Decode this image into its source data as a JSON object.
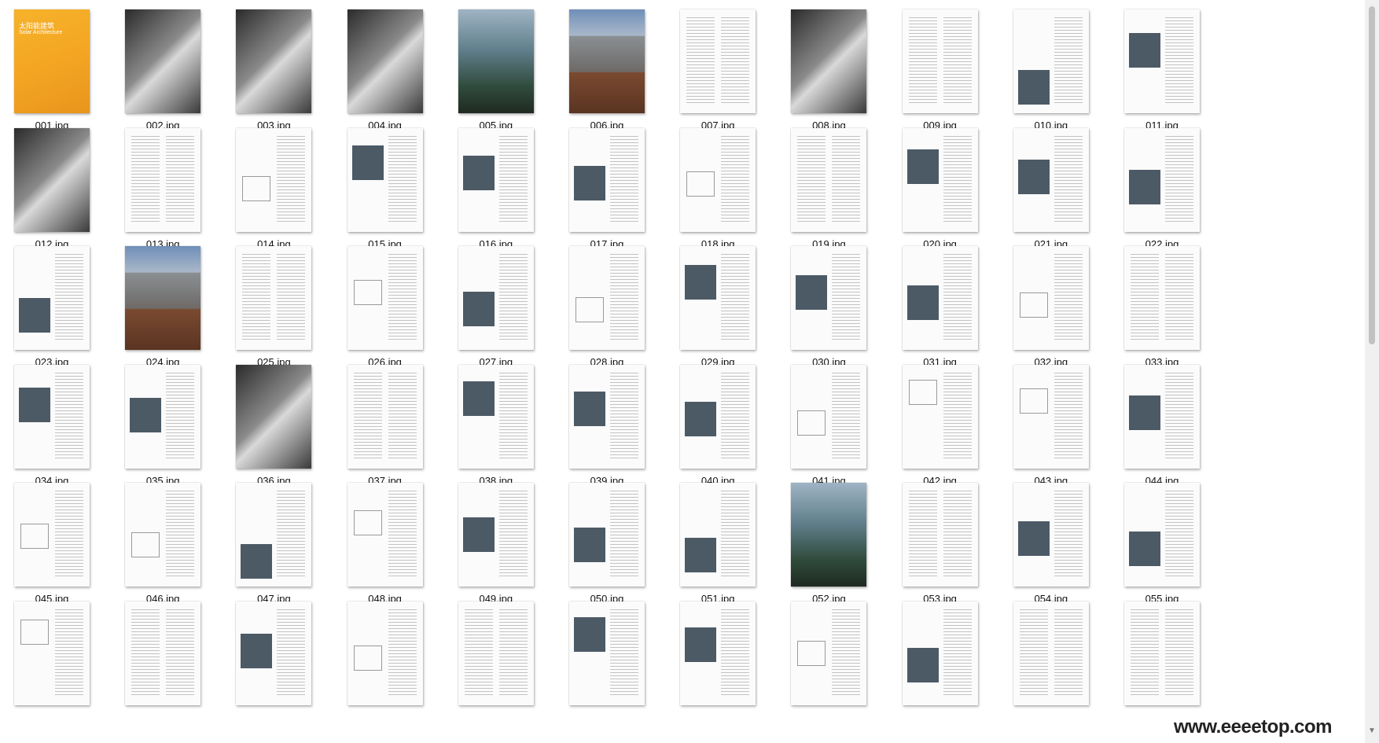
{
  "files": [
    {
      "name": "001.jpg",
      "kind": "cover",
      "cover_title": "太阳能建筑",
      "cover_subtitle": "Solar Architecture"
    },
    {
      "name": "002.jpg",
      "kind": "photo-dark"
    },
    {
      "name": "003.jpg",
      "kind": "photo-dark"
    },
    {
      "name": "004.jpg",
      "kind": "photo-dark"
    },
    {
      "name": "005.jpg",
      "kind": "photo-glass"
    },
    {
      "name": "006.jpg",
      "kind": "photo-building"
    },
    {
      "name": "007.jpg",
      "kind": "text"
    },
    {
      "name": "008.jpg",
      "kind": "photo-dark"
    },
    {
      "name": "009.jpg",
      "kind": "text"
    },
    {
      "name": "010.jpg",
      "kind": "text-photo"
    },
    {
      "name": "011.jpg",
      "kind": "text-photo"
    },
    {
      "name": "012.jpg",
      "kind": "photo-dark"
    },
    {
      "name": "013.jpg",
      "kind": "text"
    },
    {
      "name": "014.jpg",
      "kind": "text-diagram"
    },
    {
      "name": "015.jpg",
      "kind": "text-photo"
    },
    {
      "name": "016.jpg",
      "kind": "text-photo"
    },
    {
      "name": "017.jpg",
      "kind": "text-photo"
    },
    {
      "name": "018.jpg",
      "kind": "text-diagram"
    },
    {
      "name": "019.jpg",
      "kind": "text"
    },
    {
      "name": "020.jpg",
      "kind": "text-photo"
    },
    {
      "name": "021.jpg",
      "kind": "text-photo"
    },
    {
      "name": "022.jpg",
      "kind": "text-photo"
    },
    {
      "name": "023.jpg",
      "kind": "text-photo"
    },
    {
      "name": "024.jpg",
      "kind": "photo-building"
    },
    {
      "name": "025.jpg",
      "kind": "text"
    },
    {
      "name": "026.jpg",
      "kind": "text-diagram"
    },
    {
      "name": "027.jpg",
      "kind": "text-photo"
    },
    {
      "name": "028.jpg",
      "kind": "text-diagram"
    },
    {
      "name": "029.jpg",
      "kind": "text-photo"
    },
    {
      "name": "030.jpg",
      "kind": "text-photo"
    },
    {
      "name": "031.jpg",
      "kind": "text-photo"
    },
    {
      "name": "032.jpg",
      "kind": "text-diagram"
    },
    {
      "name": "033.jpg",
      "kind": "text"
    },
    {
      "name": "034.jpg",
      "kind": "text-photo"
    },
    {
      "name": "035.jpg",
      "kind": "text-photo"
    },
    {
      "name": "036.jpg",
      "kind": "photo-dark"
    },
    {
      "name": "037.jpg",
      "kind": "text"
    },
    {
      "name": "038.jpg",
      "kind": "text-photo"
    },
    {
      "name": "039.jpg",
      "kind": "text-photo"
    },
    {
      "name": "040.jpg",
      "kind": "text-photo"
    },
    {
      "name": "041.jpg",
      "kind": "text-diagram"
    },
    {
      "name": "042.jpg",
      "kind": "text-diagram"
    },
    {
      "name": "043.jpg",
      "kind": "text-diagram"
    },
    {
      "name": "044.jpg",
      "kind": "text-photo"
    },
    {
      "name": "045.jpg",
      "kind": "text-diagram"
    },
    {
      "name": "046.jpg",
      "kind": "text-diagram"
    },
    {
      "name": "047.jpg",
      "kind": "text-photo"
    },
    {
      "name": "048.jpg",
      "kind": "text-diagram"
    },
    {
      "name": "049.jpg",
      "kind": "text-photo"
    },
    {
      "name": "050.jpg",
      "kind": "text-photo"
    },
    {
      "name": "051.jpg",
      "kind": "text-photo"
    },
    {
      "name": "052.jpg",
      "kind": "photo-glass"
    },
    {
      "name": "053.jpg",
      "kind": "text"
    },
    {
      "name": "054.jpg",
      "kind": "text-photo"
    },
    {
      "name": "055.jpg",
      "kind": "text-photo"
    },
    {
      "name": "",
      "kind": "text-diagram"
    },
    {
      "name": "",
      "kind": "text"
    },
    {
      "name": "",
      "kind": "text-photo"
    },
    {
      "name": "",
      "kind": "text-diagram"
    },
    {
      "name": "",
      "kind": "text"
    },
    {
      "name": "",
      "kind": "text-photo"
    },
    {
      "name": "",
      "kind": "text-photo"
    },
    {
      "name": "",
      "kind": "text-diagram"
    },
    {
      "name": "",
      "kind": "text-photo"
    },
    {
      "name": "",
      "kind": "text"
    },
    {
      "name": "",
      "kind": "text"
    }
  ],
  "watermark": "www.eeeetop.com",
  "scroll_arrow_icon": "chevron-down-icon",
  "colors": {
    "cover": "#f4a623",
    "background": "#ffffff",
    "label": "#111111"
  }
}
